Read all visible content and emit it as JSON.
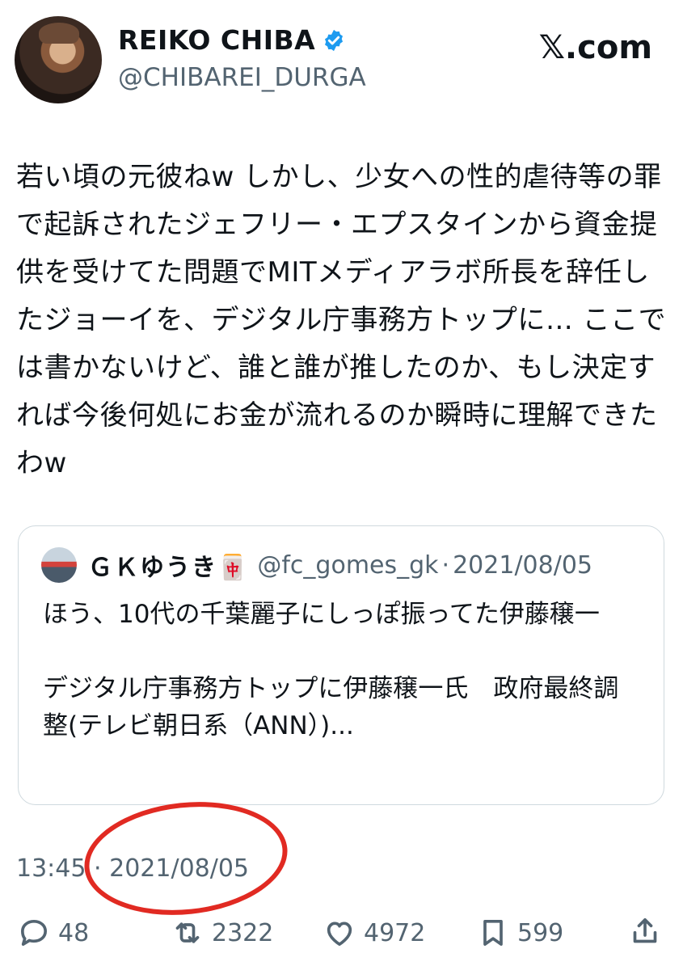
{
  "author": {
    "display_name": "REIKO CHIBA",
    "handle": "@CHIBAREI_DURGA",
    "verified_icon": "verified-badge-icon"
  },
  "site": {
    "logo_text": "𝕏.com"
  },
  "tweet": {
    "text": "若い頃の元彼ねw しかし、少女への性的虐待等の罪で起訴されたジェフリー・エプスタインから資金提供を受けてた問題でMITメディアラボ所長を辞任したジョーイを、デジタル庁事務方トップに… ここでは書かないけど、誰と誰が推したのか、もし決定すれば今後何処にお金が流れるのか瞬時に理解できたわw"
  },
  "quote": {
    "display_name": "ＧＫゆうき🀄",
    "handle": "@fc_gomes_gk",
    "dot": "·",
    "date": "2021/08/05",
    "text": "ほう、10代の千葉麗子にしっぽ振ってた伊藤穣一\n\nデジタル庁事務方トップに伊藤穣一氏　政府最終調整(テレビ朝日系（ANN）)..."
  },
  "timestamp": {
    "time": "13:45",
    "dot": "·",
    "date": "2021/08/05"
  },
  "annotation": {
    "color": "#e12a22"
  },
  "actions": {
    "reply": {
      "icon": "reply-icon",
      "count": "48"
    },
    "repost": {
      "icon": "repost-icon",
      "count": "2322"
    },
    "like": {
      "icon": "heart-icon",
      "count": "4972"
    },
    "bookmark": {
      "icon": "bookmark-icon",
      "count": "599"
    },
    "share": {
      "icon": "share-icon"
    }
  }
}
